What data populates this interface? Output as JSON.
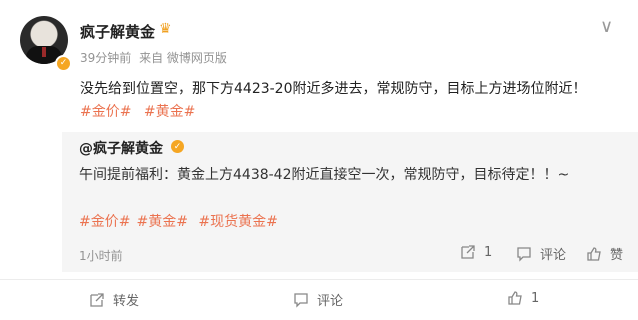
{
  "post": {
    "author": "疯子解黄金",
    "meta_time": "39分钟前",
    "meta_source": "来自 微博网页版",
    "content": "没先给到位置空，那下方4423-20附近多进去，常规防守，目标上方进场位附近！",
    "tags": [
      "#金价#",
      "#黄金#"
    ]
  },
  "repost": {
    "author": "@疯子解黄金",
    "content": "午间提前福利：黄金上方4438-42附近直接空一次，常规防守，目标待定！！~",
    "tags": [
      "#金价#",
      "#黄金#",
      "#现货黄金#"
    ],
    "time": "1小时前",
    "share_count": "1",
    "comment_label": "评论",
    "like_label": "赞"
  },
  "actions": {
    "repost_label": "转发",
    "comment_label": "评论",
    "like_count": "1"
  },
  "icons": {
    "more": "more-icon",
    "share": "share-icon",
    "comment": "comment-icon",
    "like": "like-icon",
    "verified": "verified-icon",
    "vip": "crown-icon"
  },
  "colors": {
    "accent": "#eb7350",
    "verified": "#f5a623"
  }
}
